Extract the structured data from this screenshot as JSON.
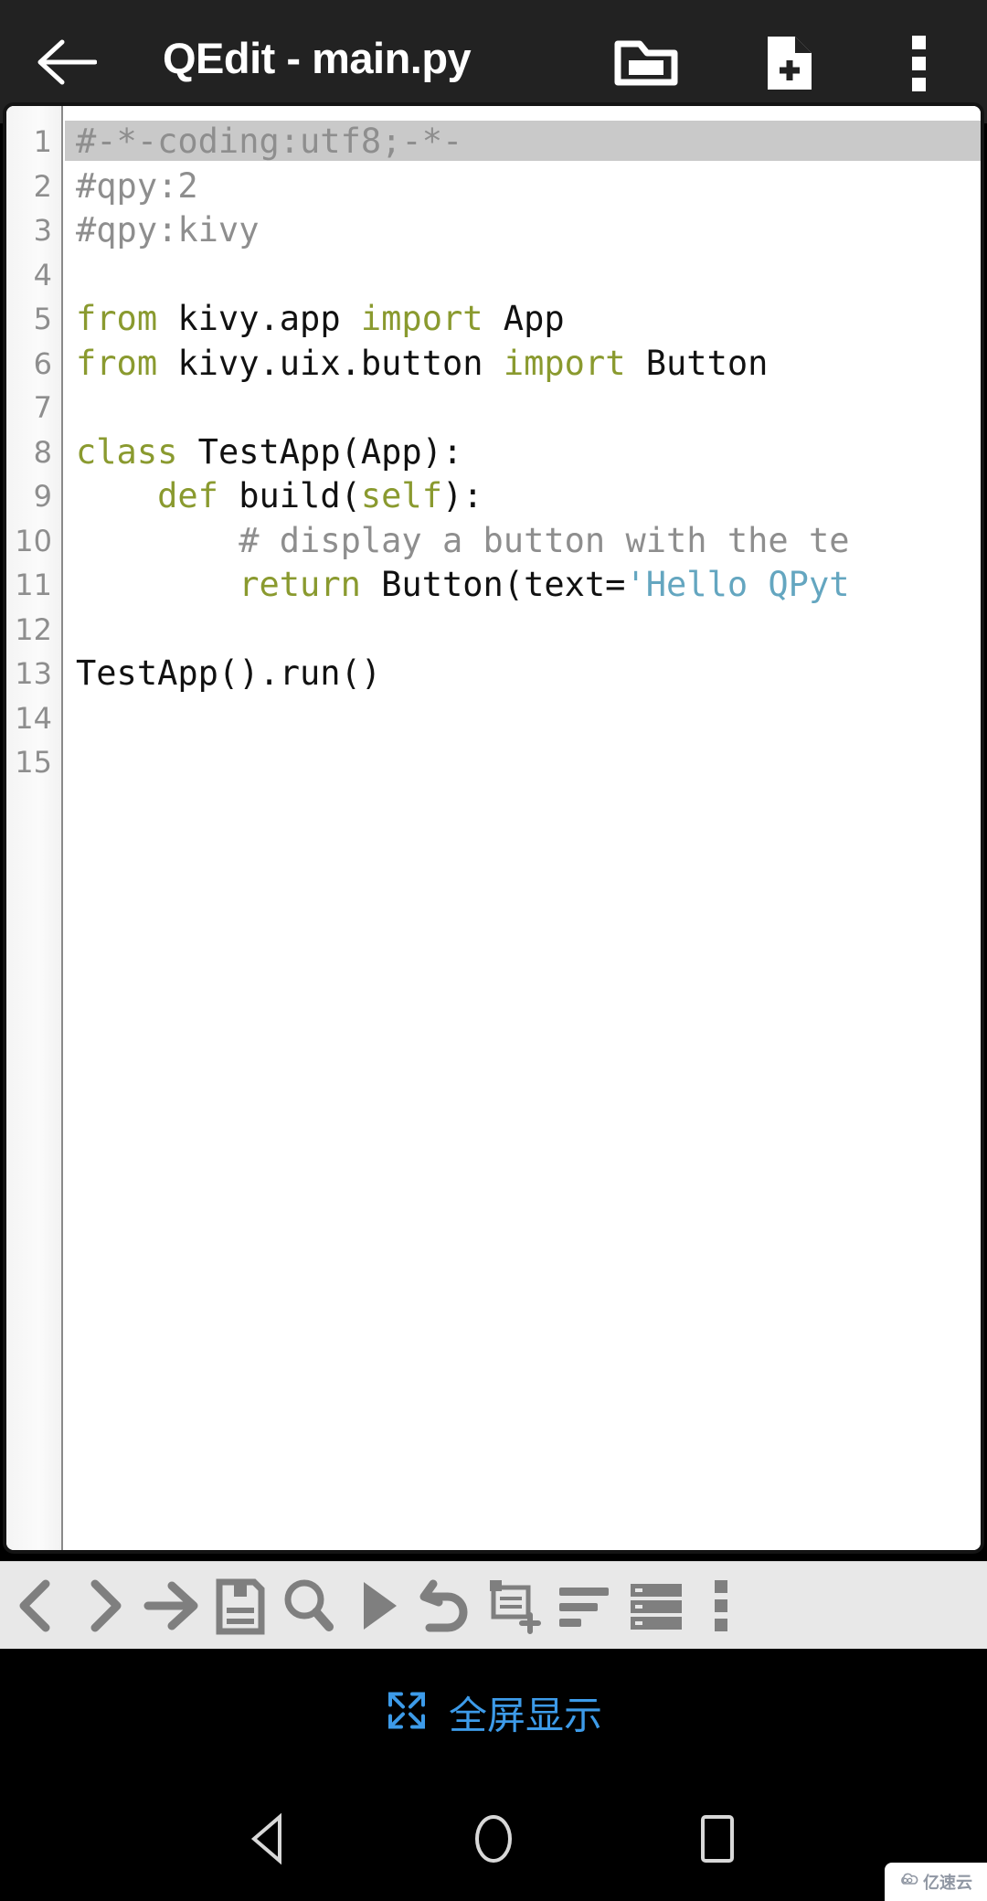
{
  "appbar": {
    "back_icon": "arrow-left-icon",
    "title": "QEdit - main.py",
    "actions": [
      {
        "name": "open-folder-button",
        "icon": "folder-open-icon",
        "label": ""
      },
      {
        "name": "new-file-button",
        "icon": "file-plus-icon",
        "label": ""
      },
      {
        "name": "appbar-overflow-button",
        "icon": "more-vertical-icon",
        "label": ""
      }
    ],
    "bg_color": "#222222",
    "fg_color": "#ffffff"
  },
  "editor": {
    "gutter_line_numbers": [
      "1",
      "2",
      "3",
      "4",
      "5",
      "6",
      "7",
      "8",
      "9",
      "10",
      "11",
      "12",
      "13",
      "14",
      "15"
    ],
    "current_line": 1,
    "current_line_highlight_color": "#c9c9c9",
    "background_color": "#ffffff",
    "total_lines": 15,
    "syntax_colors": {
      "keyword": "#8a9a2f",
      "comment": "#8e8e8e",
      "string": "#64a6c0",
      "plain": "#111111",
      "line_number": "#8e8e8e"
    },
    "lines": [
      {
        "n": "1",
        "tokens": [
          {
            "t": "#-*-coding:utf8;-*-",
            "c": "comment"
          }
        ]
      },
      {
        "n": "2",
        "tokens": [
          {
            "t": "#qpy:2",
            "c": "comment"
          }
        ]
      },
      {
        "n": "3",
        "tokens": [
          {
            "t": "#qpy:kivy",
            "c": "comment"
          }
        ]
      },
      {
        "n": "4",
        "tokens": []
      },
      {
        "n": "5",
        "tokens": [
          {
            "t": "from",
            "c": "kw"
          },
          {
            "t": " kivy.app ",
            "c": "plain"
          },
          {
            "t": "import",
            "c": "kw"
          },
          {
            "t": " App",
            "c": "plain"
          }
        ]
      },
      {
        "n": "6",
        "tokens": [
          {
            "t": "from",
            "c": "kw"
          },
          {
            "t": " kivy.uix.button ",
            "c": "plain"
          },
          {
            "t": "import",
            "c": "kw"
          },
          {
            "t": " Button",
            "c": "plain"
          }
        ]
      },
      {
        "n": "7",
        "tokens": []
      },
      {
        "n": "8",
        "tokens": [
          {
            "t": "class",
            "c": "kw"
          },
          {
            "t": " TestApp(App):",
            "c": "plain"
          }
        ]
      },
      {
        "n": "9",
        "tokens": [
          {
            "t": "    ",
            "c": "plain"
          },
          {
            "t": "def",
            "c": "kw"
          },
          {
            "t": " build(",
            "c": "plain"
          },
          {
            "t": "self",
            "c": "kw"
          },
          {
            "t": "):",
            "c": "plain"
          }
        ]
      },
      {
        "n": "10",
        "tokens": [
          {
            "t": "        ",
            "c": "plain"
          },
          {
            "t": "# display a button with the te",
            "c": "comment"
          }
        ]
      },
      {
        "n": "11",
        "tokens": [
          {
            "t": "        ",
            "c": "plain"
          },
          {
            "t": "return",
            "c": "kw"
          },
          {
            "t": " Button(text=",
            "c": "plain"
          },
          {
            "t": "'Hello QPyt",
            "c": "str"
          }
        ]
      },
      {
        "n": "12",
        "tokens": []
      },
      {
        "n": "13",
        "tokens": [
          {
            "t": "TestApp().run()",
            "c": "plain"
          }
        ]
      },
      {
        "n": "14",
        "tokens": []
      },
      {
        "n": "15",
        "tokens": []
      }
    ]
  },
  "toolbar": {
    "bg_color": "#e8e8e8",
    "icon_color": "#7f7f7f",
    "buttons": [
      {
        "name": "prev-button",
        "icon": "chevron-left-icon"
      },
      {
        "name": "next-button",
        "icon": "chevron-right-icon"
      },
      {
        "name": "indent-tab-button",
        "icon": "arrow-right-icon"
      },
      {
        "name": "save-button",
        "icon": "floppy-disk-icon"
      },
      {
        "name": "search-button",
        "icon": "magnifier-icon"
      },
      {
        "name": "run-button",
        "icon": "play-icon"
      },
      {
        "name": "undo-button",
        "icon": "undo-arrow-icon"
      },
      {
        "name": "insert-snippet-button",
        "icon": "window-plus-icon"
      },
      {
        "name": "format-lines-button",
        "icon": "align-left-icon"
      },
      {
        "name": "list-view-button",
        "icon": "list-rows-icon"
      },
      {
        "name": "toolbar-overflow-button",
        "icon": "more-vertical-icon"
      }
    ]
  },
  "fullscreen_hint": {
    "icon": "expand-fullscreen-icon",
    "label": "全屏显示",
    "color": "#3d9be9",
    "bg_color": "#000000"
  },
  "navbar": {
    "bg_color": "#000000",
    "buttons": [
      {
        "name": "android-back-button",
        "icon": "triangle-left-icon"
      },
      {
        "name": "android-home-button",
        "icon": "circle-icon"
      },
      {
        "name": "android-recents-button",
        "icon": "square-icon"
      }
    ]
  },
  "watermark": {
    "text": "亿速云",
    "icon": "cloud-logo-icon"
  }
}
